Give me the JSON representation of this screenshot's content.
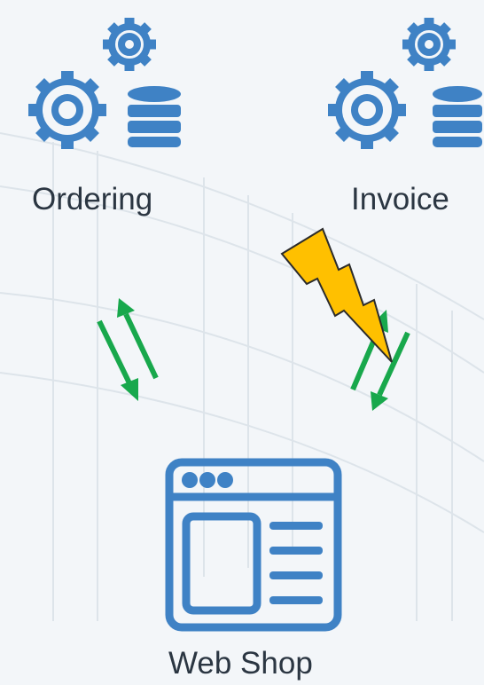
{
  "colors": {
    "icon_blue": "#3f82c5",
    "arrow_green": "#18a84c",
    "lightning_fill": "#ffc000",
    "lightning_stroke": "#2b2b2b",
    "label_text": "#2b3642"
  },
  "nodes": {
    "ordering": {
      "label": "Ordering",
      "icon": "gears-database-icon"
    },
    "invoice": {
      "label": "Invoice",
      "icon": "gears-database-icon"
    },
    "webshop": {
      "label": "Web Shop",
      "icon": "browser-window-icon"
    }
  },
  "connections": [
    {
      "from": "webshop",
      "to": "ordering",
      "direction": "bidirectional",
      "status": "ok"
    },
    {
      "from": "webshop",
      "to": "invoice",
      "direction": "bidirectional",
      "status": "failure",
      "marker": "lightning-icon"
    }
  ]
}
